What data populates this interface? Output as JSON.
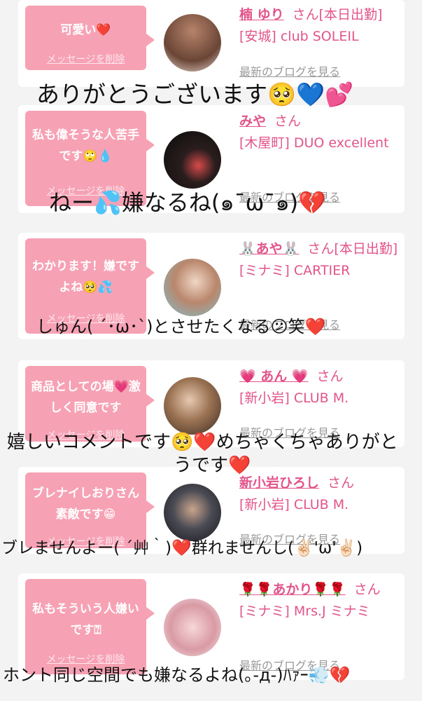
{
  "cards": [
    {
      "comment": "可愛い❤️",
      "delete": "メッセージを削除",
      "name": "楠 ゆり",
      "san": "さん[本日出勤]",
      "shop": "[安城] club SOLEIL",
      "blog": "最新のブログを見る"
    },
    {
      "comment": "私も偉そうな人苦手です🙄💧",
      "delete": "メッセージを削除",
      "name": "みや",
      "san": "さん",
      "shop": "[木屋町] DUO excellent",
      "blog": "最新のブログを見る"
    },
    {
      "comment": "わかります！嫌ですよね🥺💦",
      "delete": "メッセージを削除",
      "name": "🐰あや🐰",
      "san": "さん[本日出勤]",
      "shop": "[ミナミ] CARTIER",
      "blog": "最新のブログを見る"
    },
    {
      "comment": "商品としての場💗激しく同意です",
      "delete": "メッセージを削除",
      "name": "💗 あん 💗",
      "san": "さん",
      "shop": "[新小岩] CLUB M.",
      "blog": "最新のブログを見る"
    },
    {
      "comment": "ブレナイしおりさん素敵です😁",
      "delete": "メッセージを削除",
      "name": "新小岩ひろし",
      "san": "さん",
      "shop": "[新小岩] CLUB M.",
      "blog": "最新のブログを見る"
    },
    {
      "comment": "私もそういう人嫌いです⍰",
      "delete": "メッセージを削除",
      "name": "🌹🌹あかり🌹🌹",
      "san": "さん",
      "shop": "[ミナミ] Mrs.J ミナミ",
      "blog": "最新のブログを見る"
    }
  ],
  "overlays": [
    "ありがとうございます🥺💙💕",
    "ねー💦嫌なるね(๑¯ω¯๑)💔",
    "しゅん( ´･ω･`)とさせたくなる😕笑❤️",
    "嬉しいコメントです🥺❤️めちゃくちゃありがと",
    "うです❤️",
    "ブレませんよー( ´艸｀)❤️群れませんし(✌🏻'ω'✌🏻)",
    "ホント同じ空間でも嫌なるよね(｡-д-)ﾊｧｰ💨💔"
  ],
  "colors": {
    "bubble": "#f7a2b4",
    "name": "#e2548a",
    "link": "#9a9a9a"
  }
}
